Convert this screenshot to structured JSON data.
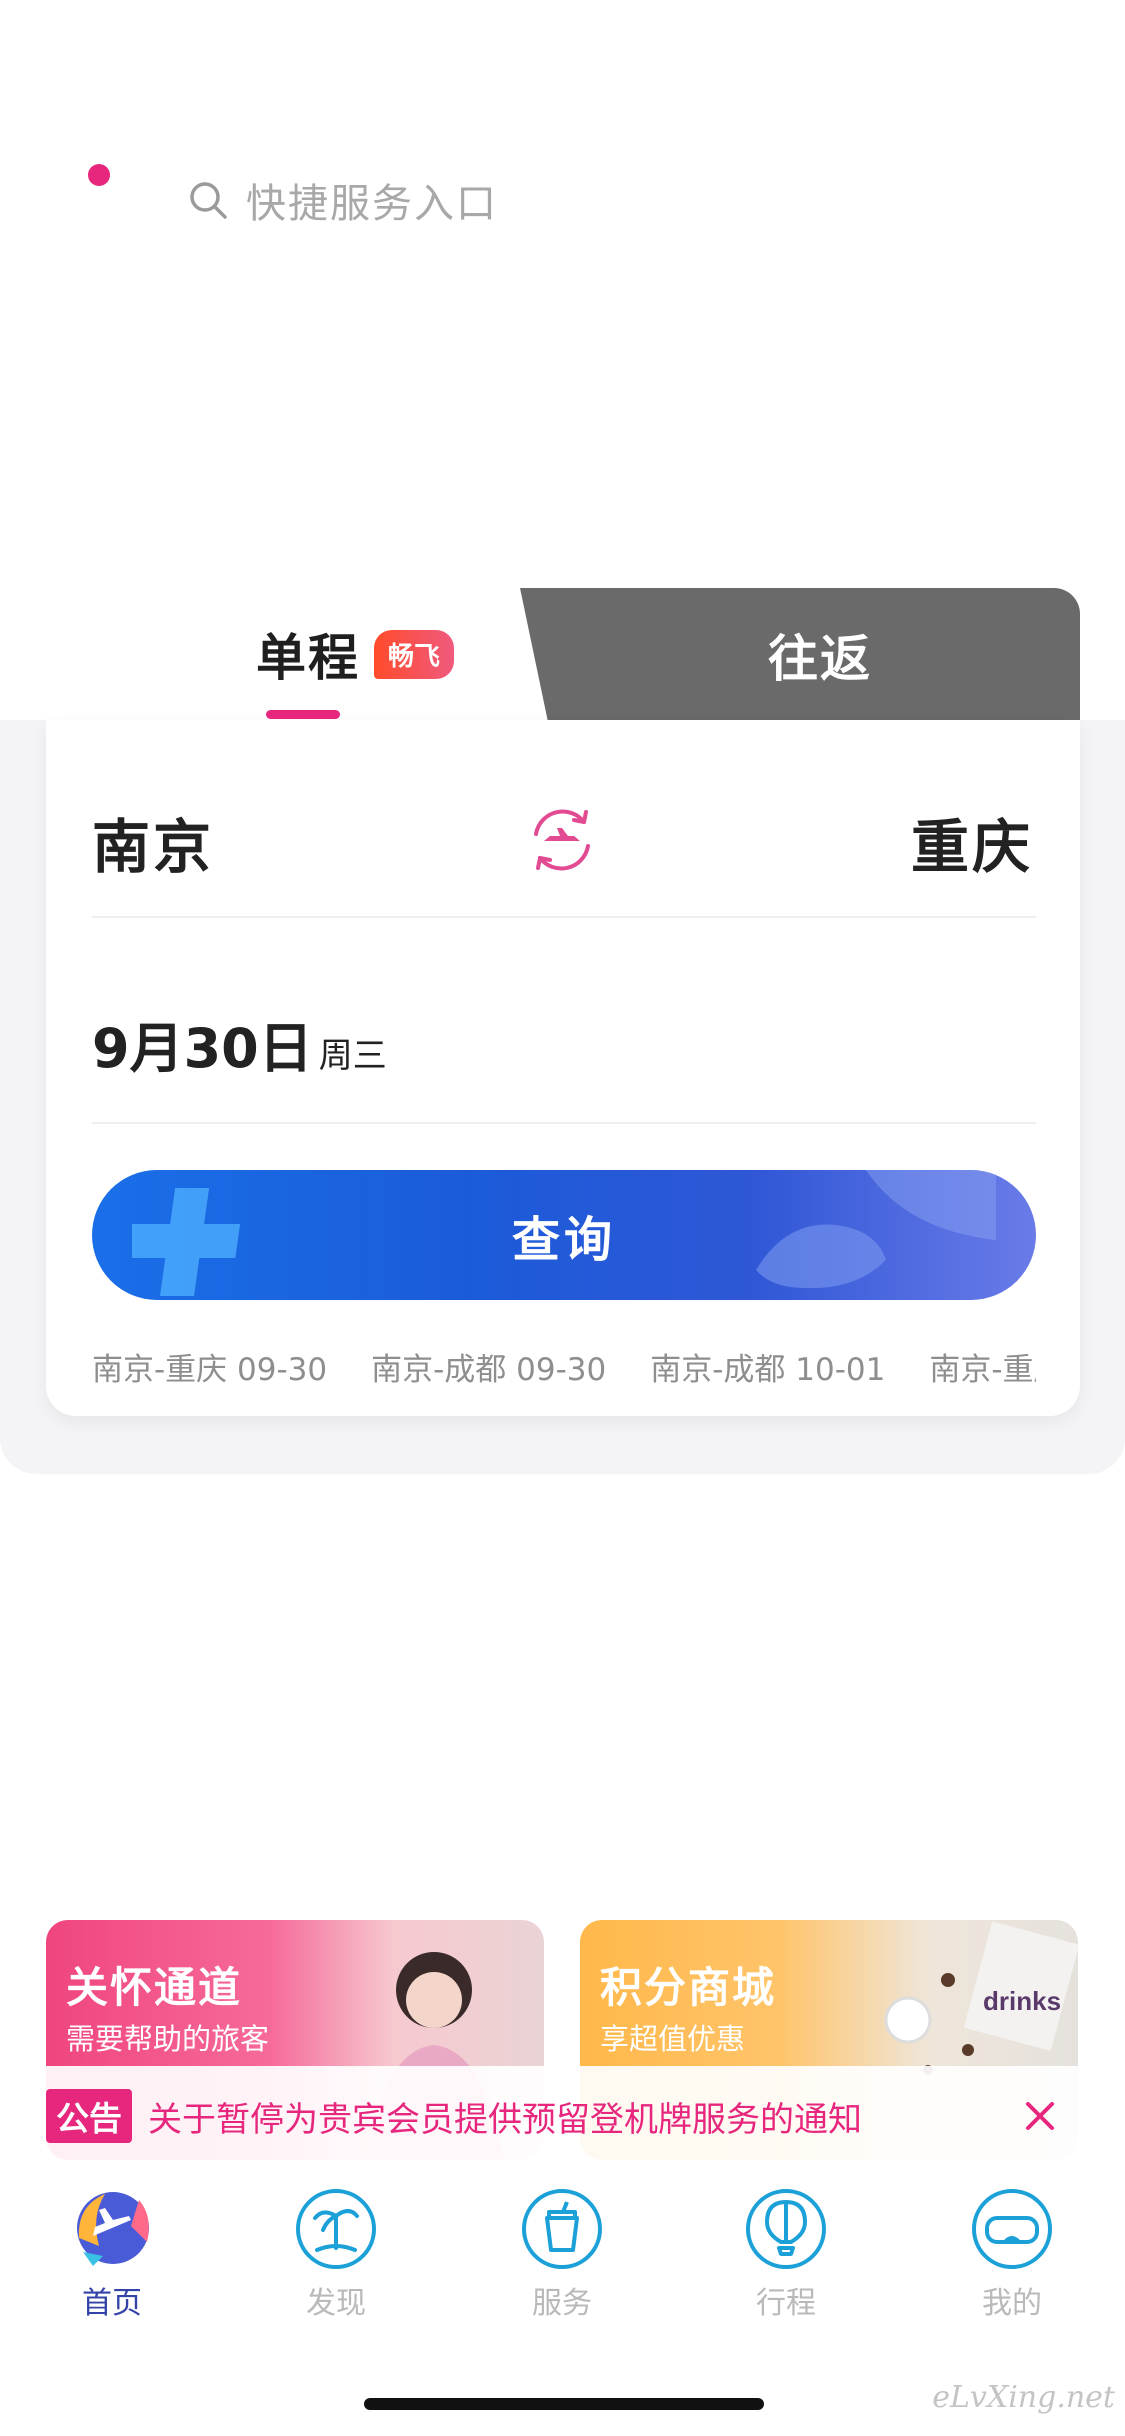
{
  "search": {
    "placeholder": "快捷服务入口"
  },
  "booking": {
    "tab_one_way": "单程",
    "tab_badge": "畅飞",
    "tab_round_trip": "往返",
    "from_city": "南京",
    "to_city": "重庆",
    "date": "9月30日",
    "weekday": "周三",
    "query_label": "查询",
    "history": [
      "南京-重庆 09-30",
      "南京-成都 09-30",
      "南京-成都 10-01",
      "南京-重庆"
    ]
  },
  "promos": [
    {
      "title": "关怀通道",
      "subtitle": "需要帮助的旅客"
    },
    {
      "title": "积分商城",
      "subtitle": "享超值优惠"
    }
  ],
  "notice": {
    "tag": "公告",
    "text": "关于暂停为贵宾会员提供预留登机牌服务的通知"
  },
  "tabbar": {
    "items": [
      {
        "label": "首页",
        "icon": "plane-home-icon",
        "active": true
      },
      {
        "label": "发现",
        "icon": "palm-tree-icon",
        "active": false
      },
      {
        "label": "服务",
        "icon": "drink-cup-icon",
        "active": false
      },
      {
        "label": "行程",
        "icon": "hot-air-balloon-icon",
        "active": false
      },
      {
        "label": "我的",
        "icon": "vr-glasses-icon",
        "active": false
      }
    ]
  },
  "watermark": "eLvXing.net",
  "colors": {
    "accent": "#e6277d",
    "query_blue": "#1b5bd9",
    "active_tab": "#3343a8"
  }
}
